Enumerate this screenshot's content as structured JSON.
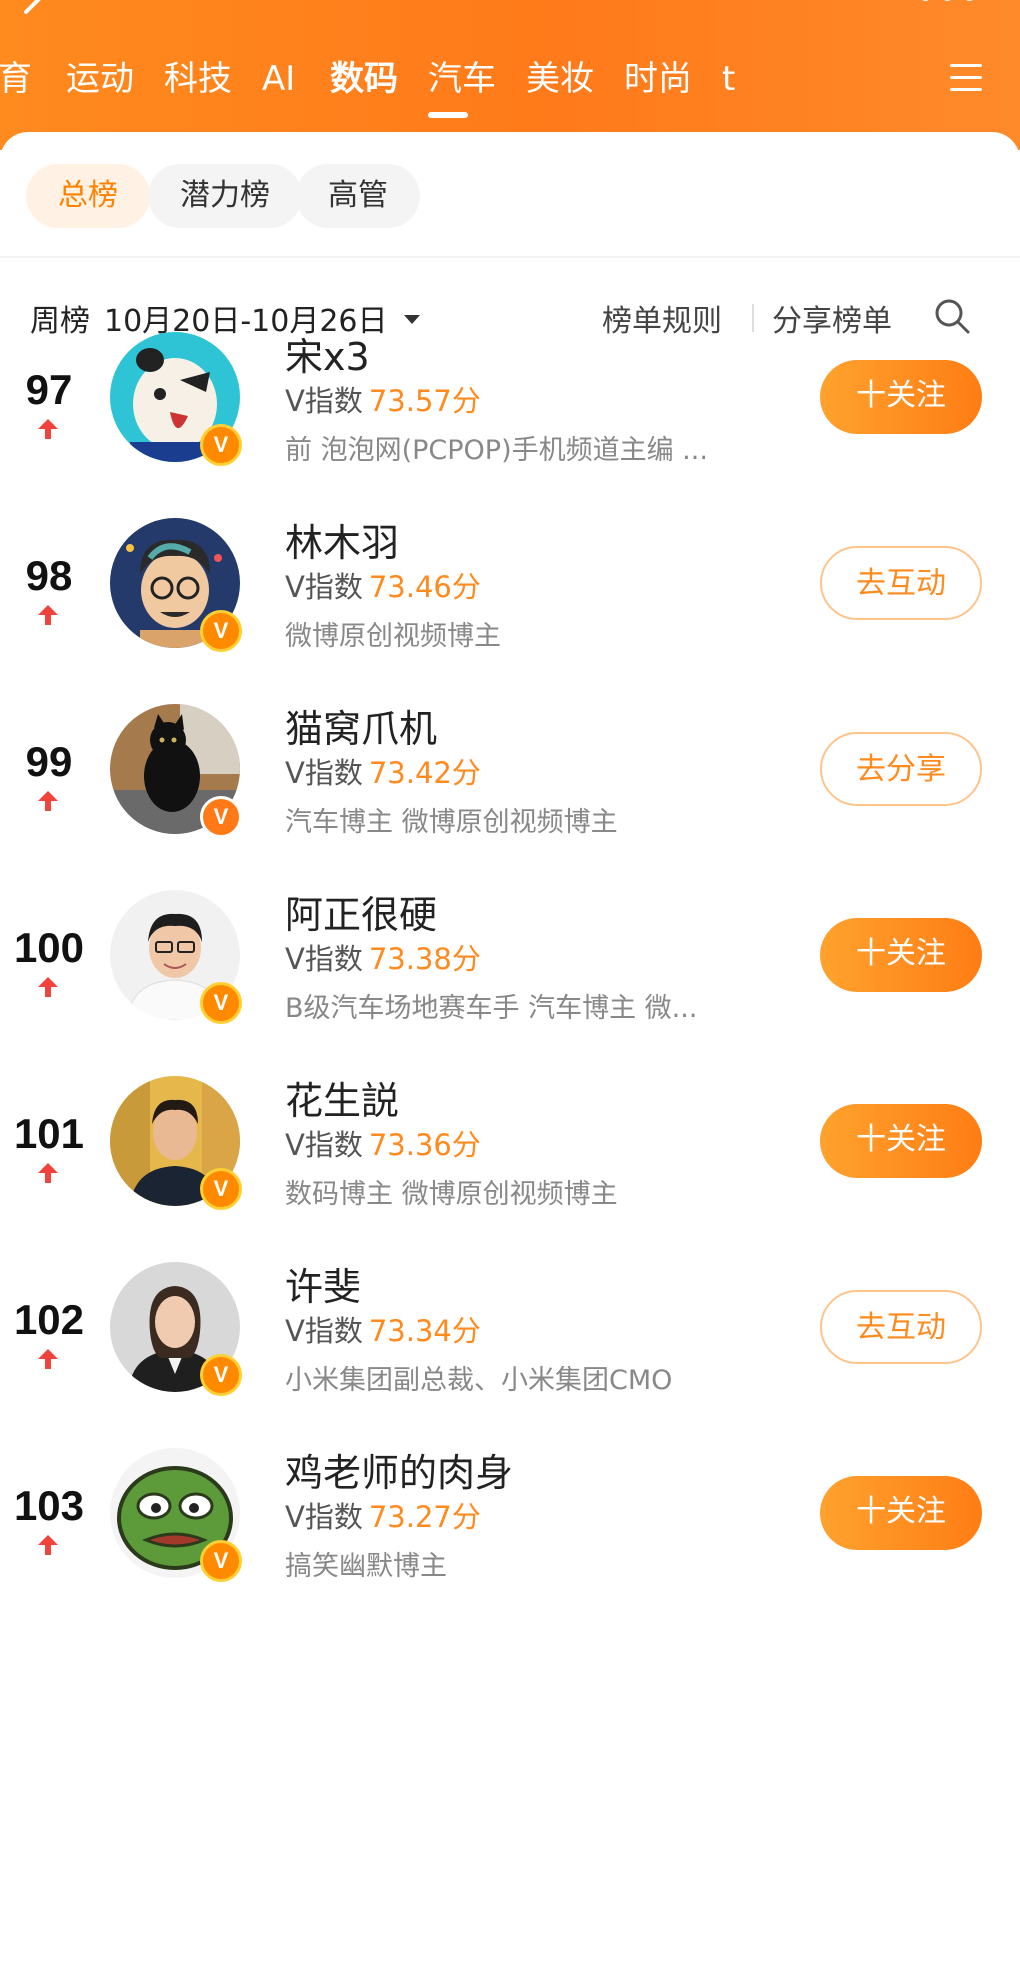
{
  "header": {
    "tabs": [
      "育",
      "运动",
      "科技",
      "AI",
      "数码",
      "汽车",
      "美妆",
      "时尚",
      "t"
    ],
    "active_tab_index": 4
  },
  "filters": {
    "pills": [
      "总榜",
      "潜力榜",
      "高管"
    ],
    "active_pill_index": 0
  },
  "week": {
    "label": "周榜",
    "range": "10月20日-10月26日",
    "rules": "榜单规则",
    "share": "分享榜单"
  },
  "list": [
    {
      "rank": "97",
      "name": "宋x3",
      "score_label": "V指数",
      "score": "73.57分",
      "desc": "前 泡泡网(PCPOP)手机频道主编 ...",
      "button": "十关注",
      "button_style": "follow",
      "avatar": "cartoon-panda"
    },
    {
      "rank": "98",
      "name": "林木羽",
      "score_label": "V指数",
      "score": "73.46分",
      "desc": "微博原创视频博主",
      "button": "去互动",
      "button_style": "outline",
      "avatar": "cartoon-glasses"
    },
    {
      "rank": "99",
      "name": "猫窝爪机",
      "score_label": "V指数",
      "score": "73.42分",
      "desc": "汽车博主 微博原创视频博主",
      "button": "去分享",
      "button_style": "outline",
      "avatar": "black-cat-photo"
    },
    {
      "rank": "100",
      "name": "阿正很硬",
      "score_label": "V指数",
      "score": "73.38分",
      "desc": "B级汽车场地赛车手 汽车博主 微...",
      "button": "十关注",
      "button_style": "follow",
      "avatar": "man-white-hoodie"
    },
    {
      "rank": "101",
      "name": "花生説",
      "score_label": "V指数",
      "score": "73.36分",
      "desc": "数码博主 微博原创视频博主",
      "button": "十关注",
      "button_style": "follow",
      "avatar": "man-dark-shirt"
    },
    {
      "rank": "102",
      "name": "许斐",
      "score_label": "V指数",
      "score": "73.34分",
      "desc": "小米集团副总裁、小米集团CMO",
      "button": "去互动",
      "button_style": "outline",
      "avatar": "woman-suit"
    },
    {
      "rank": "103",
      "name": "鸡老师的肉身",
      "score_label": "V指数",
      "score": "73.27分",
      "desc": "搞笑幽默博主",
      "button": "十关注",
      "button_style": "follow",
      "avatar": "cartoon-frog"
    }
  ],
  "colors": {
    "brand_orange": "#ff8200",
    "score_orange": "#ff8a1e",
    "trend_red": "#f0433e"
  }
}
